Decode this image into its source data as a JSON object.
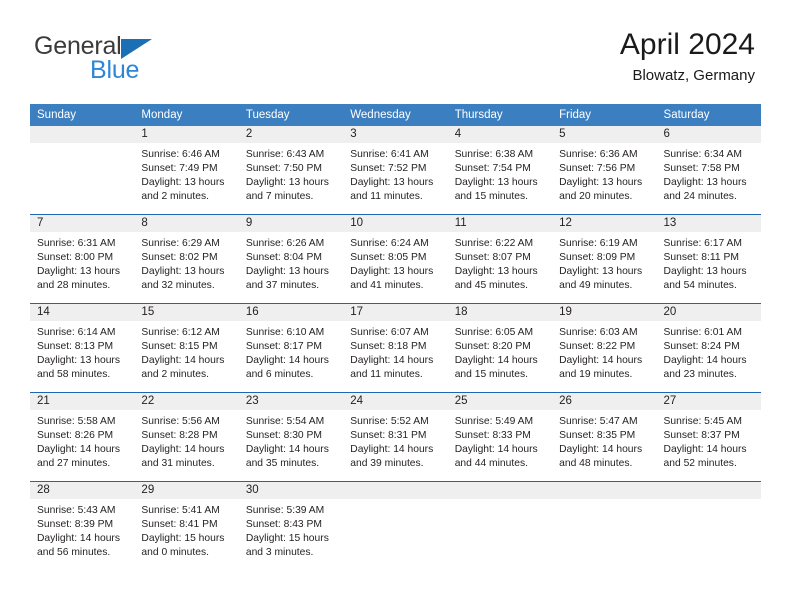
{
  "brand": {
    "name_part1": "General",
    "name_part2": "Blue",
    "triangle_color": "#1a6fb5",
    "blue_text_color": "#2e86d6"
  },
  "header": {
    "title": "April 2024",
    "subtitle": "Blowatz, Germany"
  },
  "theme": {
    "header_bar_color": "#3c7fc1",
    "week_separator_color": "#1f66ae",
    "daynumber_band_color": "#efefef",
    "text_color": "#231f20"
  },
  "weekdays": [
    "Sunday",
    "Monday",
    "Tuesday",
    "Wednesday",
    "Thursday",
    "Friday",
    "Saturday"
  ],
  "weeks": [
    {
      "days": [
        {
          "number": "",
          "lines": []
        },
        {
          "number": "1",
          "lines": [
            "Sunrise: 6:46 AM",
            "Sunset: 7:49 PM",
            "Daylight: 13 hours",
            "and 2 minutes."
          ]
        },
        {
          "number": "2",
          "lines": [
            "Sunrise: 6:43 AM",
            "Sunset: 7:50 PM",
            "Daylight: 13 hours",
            "and 7 minutes."
          ]
        },
        {
          "number": "3",
          "lines": [
            "Sunrise: 6:41 AM",
            "Sunset: 7:52 PM",
            "Daylight: 13 hours",
            "and 11 minutes."
          ]
        },
        {
          "number": "4",
          "lines": [
            "Sunrise: 6:38 AM",
            "Sunset: 7:54 PM",
            "Daylight: 13 hours",
            "and 15 minutes."
          ]
        },
        {
          "number": "5",
          "lines": [
            "Sunrise: 6:36 AM",
            "Sunset: 7:56 PM",
            "Daylight: 13 hours",
            "and 20 minutes."
          ]
        },
        {
          "number": "6",
          "lines": [
            "Sunrise: 6:34 AM",
            "Sunset: 7:58 PM",
            "Daylight: 13 hours",
            "and 24 minutes."
          ]
        }
      ]
    },
    {
      "days": [
        {
          "number": "7",
          "lines": [
            "Sunrise: 6:31 AM",
            "Sunset: 8:00 PM",
            "Daylight: 13 hours",
            "and 28 minutes."
          ]
        },
        {
          "number": "8",
          "lines": [
            "Sunrise: 6:29 AM",
            "Sunset: 8:02 PM",
            "Daylight: 13 hours",
            "and 32 minutes."
          ]
        },
        {
          "number": "9",
          "lines": [
            "Sunrise: 6:26 AM",
            "Sunset: 8:04 PM",
            "Daylight: 13 hours",
            "and 37 minutes."
          ]
        },
        {
          "number": "10",
          "lines": [
            "Sunrise: 6:24 AM",
            "Sunset: 8:05 PM",
            "Daylight: 13 hours",
            "and 41 minutes."
          ]
        },
        {
          "number": "11",
          "lines": [
            "Sunrise: 6:22 AM",
            "Sunset: 8:07 PM",
            "Daylight: 13 hours",
            "and 45 minutes."
          ]
        },
        {
          "number": "12",
          "lines": [
            "Sunrise: 6:19 AM",
            "Sunset: 8:09 PM",
            "Daylight: 13 hours",
            "and 49 minutes."
          ]
        },
        {
          "number": "13",
          "lines": [
            "Sunrise: 6:17 AM",
            "Sunset: 8:11 PM",
            "Daylight: 13 hours",
            "and 54 minutes."
          ]
        }
      ]
    },
    {
      "days": [
        {
          "number": "14",
          "lines": [
            "Sunrise: 6:14 AM",
            "Sunset: 8:13 PM",
            "Daylight: 13 hours",
            "and 58 minutes."
          ]
        },
        {
          "number": "15",
          "lines": [
            "Sunrise: 6:12 AM",
            "Sunset: 8:15 PM",
            "Daylight: 14 hours",
            "and 2 minutes."
          ]
        },
        {
          "number": "16",
          "lines": [
            "Sunrise: 6:10 AM",
            "Sunset: 8:17 PM",
            "Daylight: 14 hours",
            "and 6 minutes."
          ]
        },
        {
          "number": "17",
          "lines": [
            "Sunrise: 6:07 AM",
            "Sunset: 8:18 PM",
            "Daylight: 14 hours",
            "and 11 minutes."
          ]
        },
        {
          "number": "18",
          "lines": [
            "Sunrise: 6:05 AM",
            "Sunset: 8:20 PM",
            "Daylight: 14 hours",
            "and 15 minutes."
          ]
        },
        {
          "number": "19",
          "lines": [
            "Sunrise: 6:03 AM",
            "Sunset: 8:22 PM",
            "Daylight: 14 hours",
            "and 19 minutes."
          ]
        },
        {
          "number": "20",
          "lines": [
            "Sunrise: 6:01 AM",
            "Sunset: 8:24 PM",
            "Daylight: 14 hours",
            "and 23 minutes."
          ]
        }
      ]
    },
    {
      "days": [
        {
          "number": "21",
          "lines": [
            "Sunrise: 5:58 AM",
            "Sunset: 8:26 PM",
            "Daylight: 14 hours",
            "and 27 minutes."
          ]
        },
        {
          "number": "22",
          "lines": [
            "Sunrise: 5:56 AM",
            "Sunset: 8:28 PM",
            "Daylight: 14 hours",
            "and 31 minutes."
          ]
        },
        {
          "number": "23",
          "lines": [
            "Sunrise: 5:54 AM",
            "Sunset: 8:30 PM",
            "Daylight: 14 hours",
            "and 35 minutes."
          ]
        },
        {
          "number": "24",
          "lines": [
            "Sunrise: 5:52 AM",
            "Sunset: 8:31 PM",
            "Daylight: 14 hours",
            "and 39 minutes."
          ]
        },
        {
          "number": "25",
          "lines": [
            "Sunrise: 5:49 AM",
            "Sunset: 8:33 PM",
            "Daylight: 14 hours",
            "and 44 minutes."
          ]
        },
        {
          "number": "26",
          "lines": [
            "Sunrise: 5:47 AM",
            "Sunset: 8:35 PM",
            "Daylight: 14 hours",
            "and 48 minutes."
          ]
        },
        {
          "number": "27",
          "lines": [
            "Sunrise: 5:45 AM",
            "Sunset: 8:37 PM",
            "Daylight: 14 hours",
            "and 52 minutes."
          ]
        }
      ]
    },
    {
      "days": [
        {
          "number": "28",
          "lines": [
            "Sunrise: 5:43 AM",
            "Sunset: 8:39 PM",
            "Daylight: 14 hours",
            "and 56 minutes."
          ]
        },
        {
          "number": "29",
          "lines": [
            "Sunrise: 5:41 AM",
            "Sunset: 8:41 PM",
            "Daylight: 15 hours",
            "and 0 minutes."
          ]
        },
        {
          "number": "30",
          "lines": [
            "Sunrise: 5:39 AM",
            "Sunset: 8:43 PM",
            "Daylight: 15 hours",
            "and 3 minutes."
          ]
        },
        {
          "number": "",
          "lines": []
        },
        {
          "number": "",
          "lines": []
        },
        {
          "number": "",
          "lines": []
        },
        {
          "number": "",
          "lines": []
        }
      ]
    }
  ]
}
